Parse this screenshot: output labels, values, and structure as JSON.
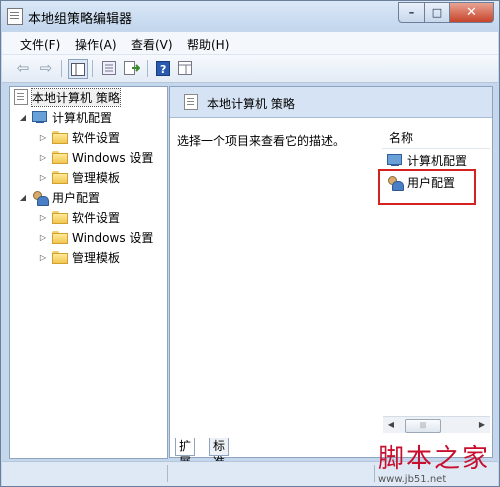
{
  "window": {
    "title": "本地组策略编辑器",
    "controls": {
      "minimize": "–",
      "maximize": "□",
      "close": "✕"
    }
  },
  "menu": [
    "文件(F)",
    "操作(A)",
    "查看(V)",
    "帮助(H)"
  ],
  "toolbar": {
    "icons": [
      "back-arrow-icon",
      "forward-arrow-icon",
      "show-tree-icon",
      "properties-icon",
      "export-icon",
      "help-icon",
      "show-pane-icon"
    ]
  },
  "tree": {
    "root": "本地计算机 策略",
    "computer": {
      "label": "计算机配置",
      "children": [
        "软件设置",
        "Windows 设置",
        "管理模板"
      ]
    },
    "user": {
      "label": "用户配置",
      "children": [
        "软件设置",
        "Windows 设置",
        "管理模板"
      ]
    }
  },
  "right_pane": {
    "header": "本地计算机 策略",
    "description": "选择一个项目来查看它的描述。",
    "column_name": "名称",
    "items": [
      "计算机配置",
      "用户配置"
    ]
  },
  "tabs": [
    "扩展",
    "标准"
  ],
  "watermark": {
    "logo_text": "脚本之家",
    "url": "www.jb51.net"
  },
  "colors": {
    "highlight_box": "#d42222",
    "window_frame": "#c4d7ec"
  }
}
